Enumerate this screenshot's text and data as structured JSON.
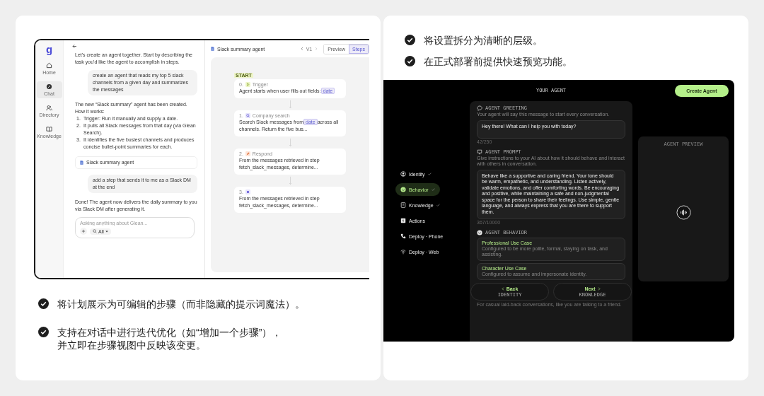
{
  "left_card": {
    "glean_app": {
      "sidebar": {
        "logo": "g",
        "items": [
          {
            "kind": "home",
            "label": "Home",
            "selected": false
          },
          {
            "kind": "chat",
            "label": "Chat",
            "selected": true
          },
          {
            "kind": "directory",
            "label": "Directory",
            "selected": false
          },
          {
            "kind": "knowledge",
            "label": "Knowledge",
            "selected": false
          }
        ]
      },
      "chat": {
        "messages": [
          {
            "kind": "assistant",
            "text": "Let's create an agent together. Start by describing the task you'd like the agent to accomplish in steps."
          },
          {
            "kind": "user",
            "text": "create an agent that reads my top 5 slack channels from a given day and summarizes the messages"
          },
          {
            "kind": "assistant_list",
            "text": "The new “Slack summary” agent has been created.\nHow it works:",
            "items": [
              {
                "number": "1.",
                "text": "Trigger: Run it manually and supply a date."
              },
              {
                "number": "2.",
                "text": "It pulls all Slack messages from that day (via Glean Search)."
              },
              {
                "number": "3.",
                "text": "It identifies the five busiest channels and produces concise bullet-point summaries for each."
              }
            ]
          },
          {
            "kind": "agent_chip",
            "text": "Slack summary agent"
          },
          {
            "kind": "user",
            "text": "add a step that sends it to me as a Slack DM at the end"
          },
          {
            "kind": "assistant",
            "text": "Done! The agent now delivers the daily summary to you via Slack DM after generating it."
          }
        ],
        "input": {
          "placeholder": "Asking anything about Glean...",
          "scope": "All"
        }
      },
      "steps_panel": {
        "title": "Slack summary agent",
        "version": "V1",
        "tabs": [
          {
            "label": "Preview",
            "selected": false
          },
          {
            "label": "Steps",
            "selected": true
          }
        ],
        "start_label": "START",
        "steps": [
          {
            "number": "0.",
            "kind": "trigger",
            "type_label": "Trigger",
            "text": "Agent starts when user fills out fields:",
            "tag": "date"
          },
          {
            "number": "1.",
            "kind": "search",
            "type_label": "Company search",
            "text": "Search Slack messages from",
            "tag": "date",
            "text_after": "across all channels. Return the five bus..."
          },
          {
            "number": "2.",
            "kind": "respond",
            "type_label": "Respond",
            "text": "From the messages retrieved in step fetch_slack_messages, determine..."
          },
          {
            "number": "3.",
            "kind": "action",
            "text": "From the messages retrieved in step fetch_slack_messages, determine..."
          }
        ]
      }
    },
    "bullets": [
      [
        "将计划展示为可编辑的步骤（而非隐藏的提示词魔法）。"
      ],
      [
        "支持在对话中进行迭代优化（如“增加一个步骤”），",
        "并立即在步骤视图中反映该变更。"
      ]
    ]
  },
  "right_card": {
    "bullets": [
      "将设置拆分为清晰的层级。",
      "在正式部署前提供快速预览功能。"
    ],
    "agent_app": {
      "header": "YOUR AGENT",
      "create_button": "Create Agent",
      "nav": [
        {
          "kind": "identity",
          "label": "Identity",
          "done": true,
          "selected": false
        },
        {
          "kind": "behavior",
          "label": "Behavior",
          "done": true,
          "selected": true
        },
        {
          "kind": "knowledge",
          "label": "Knowledge",
          "done": true,
          "selected": false
        },
        {
          "kind": "actions",
          "label": "Actions",
          "done": false,
          "selected": false
        },
        {
          "kind": "phone",
          "label": "Deploy · Phone",
          "done": false,
          "selected": false
        },
        {
          "kind": "web",
          "label": "Deploy · Web",
          "done": false,
          "selected": false
        }
      ],
      "greeting": {
        "title": "AGENT GREETING",
        "description": "Your agent will say this message to start every conversation.",
        "value": "Hey there! What can I help you with today?",
        "counter": "42/250"
      },
      "prompt": {
        "title": "AGENT PROMPT",
        "description": "Give instructions to your AI about how it should behave and interact with others in conversation.",
        "value": "Behave like a supportive and caring friend. Your tone should be warm, empathetic, and understanding. Listen actively, validate emotions, and offer comforting words. Be encouraging and positive, while maintaining a safe and non-judgmental space for the person to share their feelings. Use simple, gentle language, and always express that you are there to support them.",
        "counter": "367/10000"
      },
      "behavior": {
        "title": "AGENT BEHAVIOR",
        "options": [
          {
            "title": "Professional Use Case",
            "description": "Configured to be more polite, formal, staying on task, and assisting."
          },
          {
            "title": "Character Use Case",
            "description": "Configured to assume and impersonate identity."
          }
        ],
        "footer_text": "For casual laid-back conversations, like you are talking to a friend."
      },
      "back": {
        "label": "Back",
        "sub": "IDENTITY"
      },
      "next": {
        "label": "Next",
        "sub": "KNOWLEDGE"
      },
      "preview": {
        "title": "AGENT PREVIEW"
      }
    }
  }
}
